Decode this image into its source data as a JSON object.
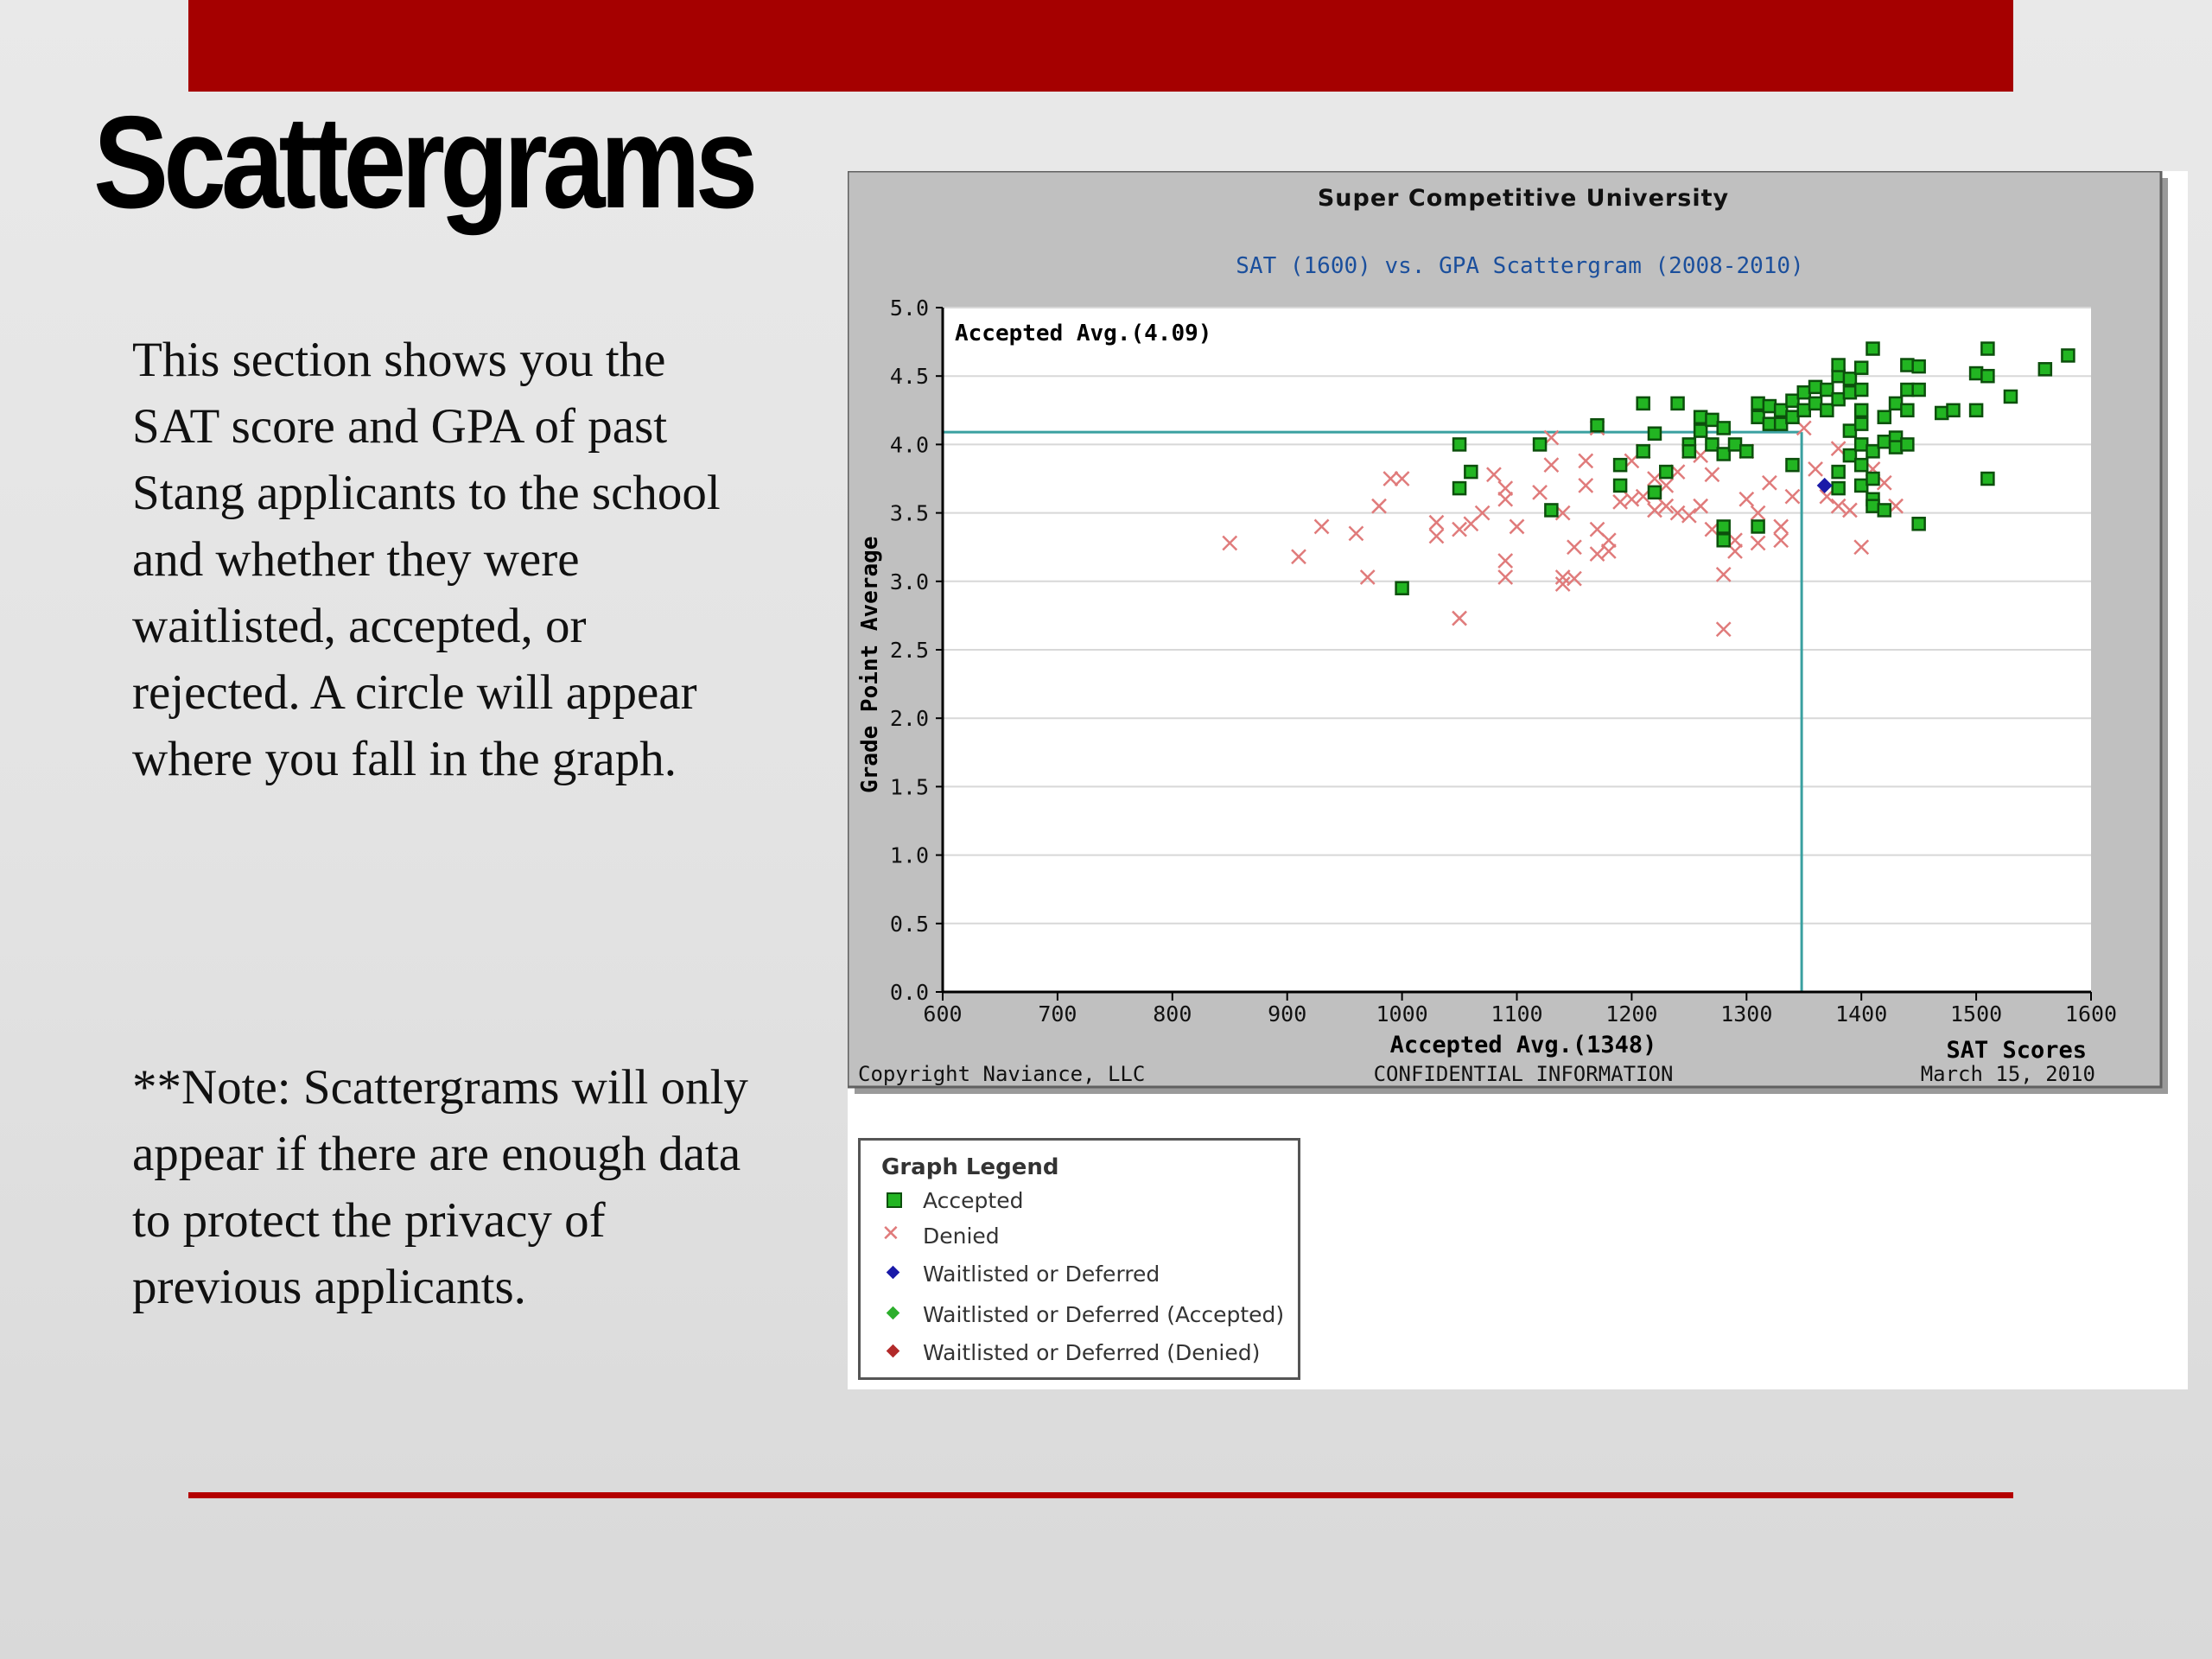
{
  "slide": {
    "title": "Scattergrams",
    "paragraph1": "This section shows you the SAT score and GPA of past Stang applicants to the school and whether they were waitlisted, accepted, or rejected.  A circle will appear where you fall in the graph.",
    "paragraph2": "**Note: Scattergrams will only appear if there are enough data to protect the privacy of previous applicants.",
    "colors": {
      "top_bar": "#a50000",
      "rule": "#b40000"
    }
  },
  "chart_data": {
    "type": "scatter",
    "title": "Super Competitive University",
    "subtitle": "SAT (1600) vs. GPA Scattergram (2008-2010)",
    "xlabel": "SAT Scores",
    "ylabel": "Grade Point Average",
    "xlim": [
      600,
      1600
    ],
    "ylim": [
      0,
      5
    ],
    "x_ticks": [
      "600",
      "700",
      "800",
      "900",
      "1000",
      "1100",
      "1200",
      "1300",
      "1400",
      "1500",
      "1600"
    ],
    "y_ticks": [
      "0.0",
      "0.5",
      "1.0",
      "1.5",
      "2.0",
      "2.5",
      "3.0",
      "3.5",
      "4.0",
      "4.5",
      "5.0"
    ],
    "grid": true,
    "accepted_avg_gpa": 4.09,
    "accepted_avg_sat": 1348,
    "accepted_avg_gpa_label": "Accepted Avg.(4.09)",
    "accepted_avg_sat_label": "Accepted Avg.(1348)",
    "footer": {
      "copyright": "Copyright Naviance, LLC",
      "confidential": "CONFIDENTIAL INFORMATION",
      "date": "March 15, 2010"
    },
    "colors": {
      "accepted": "#22b522",
      "denied": "#e07b7b",
      "waitlisted": "#1a1aa8",
      "avg_line": "#3aa0a0",
      "frame": "#c0c0c0"
    },
    "series": [
      {
        "name": "Accepted",
        "points": [
          [
            1000,
            2.95
          ],
          [
            1050,
            4.0
          ],
          [
            1050,
            3.68
          ],
          [
            1060,
            3.8
          ],
          [
            1120,
            4.0
          ],
          [
            1130,
            3.52
          ],
          [
            1170,
            4.14
          ],
          [
            1190,
            3.85
          ],
          [
            1190,
            3.7
          ],
          [
            1210,
            3.95
          ],
          [
            1210,
            4.3
          ],
          [
            1220,
            4.08
          ],
          [
            1220,
            3.65
          ],
          [
            1230,
            3.8
          ],
          [
            1240,
            4.3
          ],
          [
            1250,
            4.0
          ],
          [
            1250,
            3.95
          ],
          [
            1260,
            4.2
          ],
          [
            1260,
            4.1
          ],
          [
            1270,
            4.0
          ],
          [
            1270,
            4.18
          ],
          [
            1280,
            4.12
          ],
          [
            1280,
            3.93
          ],
          [
            1280,
            3.4
          ],
          [
            1280,
            3.3
          ],
          [
            1290,
            4.0
          ],
          [
            1300,
            3.95
          ],
          [
            1310,
            4.3
          ],
          [
            1310,
            4.2
          ],
          [
            1310,
            3.4
          ],
          [
            1320,
            4.28
          ],
          [
            1320,
            4.15
          ],
          [
            1330,
            4.25
          ],
          [
            1330,
            4.15
          ],
          [
            1340,
            4.32
          ],
          [
            1340,
            4.2
          ],
          [
            1340,
            3.85
          ],
          [
            1350,
            4.38
          ],
          [
            1350,
            4.25
          ],
          [
            1360,
            4.42
          ],
          [
            1360,
            4.3
          ],
          [
            1370,
            4.4
          ],
          [
            1370,
            4.25
          ],
          [
            1380,
            4.5
          ],
          [
            1380,
            4.58
          ],
          [
            1380,
            4.33
          ],
          [
            1380,
            3.8
          ],
          [
            1380,
            3.68
          ],
          [
            1390,
            4.38
          ],
          [
            1390,
            4.1
          ],
          [
            1390,
            3.92
          ],
          [
            1390,
            4.48
          ],
          [
            1400,
            4.56
          ],
          [
            1400,
            4.4
          ],
          [
            1400,
            4.25
          ],
          [
            1400,
            4.15
          ],
          [
            1400,
            4.0
          ],
          [
            1400,
            3.85
          ],
          [
            1400,
            3.7
          ],
          [
            1410,
            4.7
          ],
          [
            1410,
            3.95
          ],
          [
            1410,
            3.6
          ],
          [
            1410,
            3.75
          ],
          [
            1410,
            3.55
          ],
          [
            1420,
            4.2
          ],
          [
            1420,
            4.02
          ],
          [
            1420,
            3.52
          ],
          [
            1430,
            4.3
          ],
          [
            1430,
            4.05
          ],
          [
            1430,
            3.98
          ],
          [
            1440,
            4.58
          ],
          [
            1440,
            4.4
          ],
          [
            1440,
            4.25
          ],
          [
            1440,
            4.0
          ],
          [
            1450,
            4.4
          ],
          [
            1450,
            4.57
          ],
          [
            1450,
            3.42
          ],
          [
            1470,
            4.23
          ],
          [
            1480,
            4.25
          ],
          [
            1500,
            4.52
          ],
          [
            1500,
            4.25
          ],
          [
            1510,
            4.7
          ],
          [
            1510,
            4.5
          ],
          [
            1510,
            3.75
          ],
          [
            1530,
            4.35
          ],
          [
            1560,
            4.55
          ],
          [
            1580,
            4.65
          ]
        ]
      },
      {
        "name": "Denied",
        "points": [
          [
            850,
            3.28
          ],
          [
            910,
            3.18
          ],
          [
            930,
            3.4
          ],
          [
            960,
            3.35
          ],
          [
            970,
            3.03
          ],
          [
            980,
            3.55
          ],
          [
            990,
            3.75
          ],
          [
            1000,
            3.75
          ],
          [
            1030,
            3.43
          ],
          [
            1030,
            3.33
          ],
          [
            1050,
            2.73
          ],
          [
            1050,
            3.38
          ],
          [
            1060,
            3.42
          ],
          [
            1070,
            3.5
          ],
          [
            1080,
            3.78
          ],
          [
            1090,
            3.6
          ],
          [
            1090,
            3.68
          ],
          [
            1090,
            3.15
          ],
          [
            1090,
            3.03
          ],
          [
            1100,
            3.4
          ],
          [
            1120,
            3.65
          ],
          [
            1130,
            3.85
          ],
          [
            1130,
            4.05
          ],
          [
            1140,
            3.03
          ],
          [
            1140,
            3.5
          ],
          [
            1140,
            2.98
          ],
          [
            1150,
            3.02
          ],
          [
            1150,
            3.25
          ],
          [
            1160,
            3.7
          ],
          [
            1160,
            3.88
          ],
          [
            1170,
            4.12
          ],
          [
            1170,
            3.2
          ],
          [
            1170,
            3.38
          ],
          [
            1180,
            3.3
          ],
          [
            1180,
            3.22
          ],
          [
            1190,
            3.58
          ],
          [
            1200,
            3.6
          ],
          [
            1200,
            3.88
          ],
          [
            1210,
            3.62
          ],
          [
            1210,
            3.95
          ],
          [
            1220,
            3.52
          ],
          [
            1220,
            3.75
          ],
          [
            1230,
            3.55
          ],
          [
            1230,
            3.7
          ],
          [
            1240,
            3.8
          ],
          [
            1240,
            3.5
          ],
          [
            1250,
            3.48
          ],
          [
            1250,
            3.95
          ],
          [
            1260,
            3.92
          ],
          [
            1260,
            3.55
          ],
          [
            1270,
            3.78
          ],
          [
            1270,
            3.38
          ],
          [
            1280,
            3.05
          ],
          [
            1280,
            2.65
          ],
          [
            1290,
            3.3
          ],
          [
            1290,
            3.22
          ],
          [
            1300,
            3.6
          ],
          [
            1300,
            3.95
          ],
          [
            1310,
            3.28
          ],
          [
            1310,
            3.5
          ],
          [
            1320,
            3.72
          ],
          [
            1330,
            3.3
          ],
          [
            1330,
            3.4
          ],
          [
            1340,
            3.62
          ],
          [
            1350,
            4.12
          ],
          [
            1360,
            3.82
          ],
          [
            1370,
            3.62
          ],
          [
            1380,
            3.97
          ],
          [
            1380,
            3.55
          ],
          [
            1390,
            3.52
          ],
          [
            1400,
            3.25
          ],
          [
            1410,
            3.82
          ],
          [
            1420,
            3.72
          ],
          [
            1430,
            3.55
          ]
        ]
      },
      {
        "name": "Waitlisted or Deferred",
        "points": [
          [
            1368,
            3.7
          ]
        ]
      }
    ]
  },
  "legend": {
    "title": "Graph Legend",
    "items": [
      {
        "label": "Accepted",
        "symbol": "square",
        "color": "#22b522"
      },
      {
        "label": "Denied",
        "symbol": "x",
        "color": "#e07b7b"
      },
      {
        "label": "Waitlisted or Deferred",
        "symbol": "diamond",
        "color": "#1a1aa8"
      },
      {
        "label": "Waitlisted or Deferred (Accepted)",
        "symbol": "diamond",
        "color": "#2cae2c"
      },
      {
        "label": "Waitlisted or Deferred (Denied)",
        "symbol": "diamond",
        "color": "#b22a2a"
      }
    ]
  }
}
